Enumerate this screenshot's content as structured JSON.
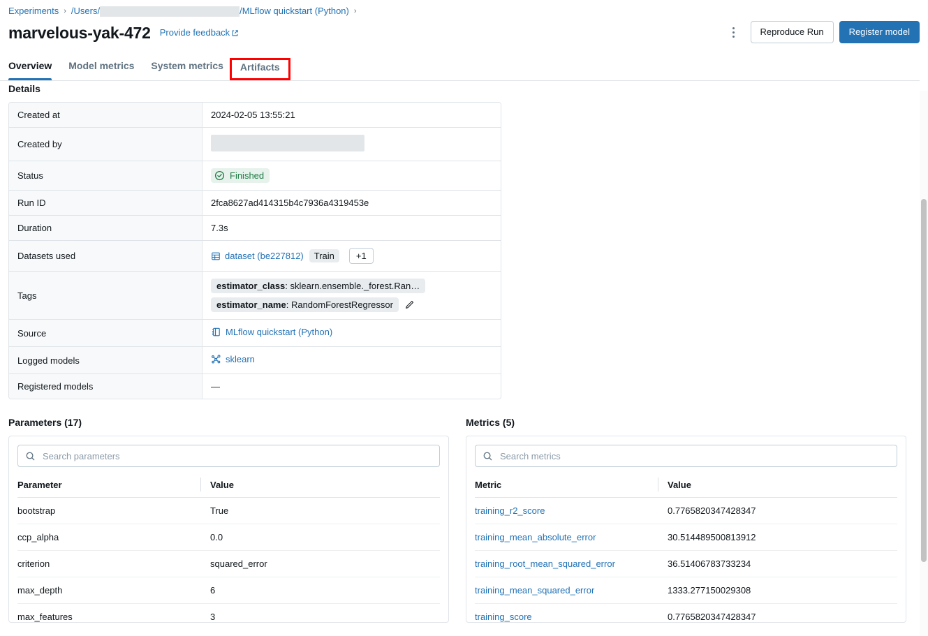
{
  "breadcrumb": {
    "root": "Experiments",
    "separator": "›",
    "path_prefix": "/Users/",
    "path_redacted": "",
    "path_suffix": "/MLflow quickstart (Python)",
    "trailing_separator": "›"
  },
  "header": {
    "run_name": "marvelous-yak-472",
    "feedback_label": "Provide feedback",
    "kebab_label": "More options",
    "reproduce_label": "Reproduce Run",
    "register_label": "Register model"
  },
  "tabs": [
    {
      "label": "Overview",
      "active": true,
      "highlighted": false
    },
    {
      "label": "Model metrics",
      "active": false,
      "highlighted": false
    },
    {
      "label": "System metrics",
      "active": false,
      "highlighted": false
    },
    {
      "label": "Artifacts",
      "active": false,
      "highlighted": true
    }
  ],
  "details": {
    "title": "Details",
    "rows": [
      {
        "label": "Created at",
        "type": "text",
        "value": "2024-02-05 13:55:21"
      },
      {
        "label": "Created by",
        "type": "redacted",
        "value": ""
      },
      {
        "label": "Status",
        "type": "status",
        "value": "Finished"
      },
      {
        "label": "Run ID",
        "type": "text",
        "value": "2fca8627ad414315b4c7936a4319453e"
      },
      {
        "label": "Duration",
        "type": "text",
        "value": "7.3s"
      },
      {
        "label": "Datasets used",
        "type": "datasets",
        "dataset_name": "dataset (be227812)",
        "dataset_tag": "Train",
        "more_count": "+1"
      },
      {
        "label": "Tags",
        "type": "tags",
        "tags": [
          {
            "key": "estimator_class",
            "value": "sklearn.ensemble._forest.Ran…"
          },
          {
            "key": "estimator_name",
            "value": "RandomForestRegressor"
          }
        ]
      },
      {
        "label": "Source",
        "type": "link",
        "value": "MLflow quickstart (Python)",
        "icon": "notebook-icon"
      },
      {
        "label": "Logged models",
        "type": "link",
        "value": "sklearn",
        "icon": "model-icon"
      },
      {
        "label": "Registered models",
        "type": "text",
        "value": "—"
      }
    ]
  },
  "parameters": {
    "title": "Parameters (17)",
    "search_placeholder": "Search parameters",
    "search_value": "",
    "columns": [
      "Parameter",
      "Value"
    ],
    "rows": [
      {
        "key": "bootstrap",
        "value": "True"
      },
      {
        "key": "ccp_alpha",
        "value": "0.0"
      },
      {
        "key": "criterion",
        "value": "squared_error"
      },
      {
        "key": "max_depth",
        "value": "6"
      },
      {
        "key": "max_features",
        "value": "3"
      }
    ]
  },
  "metrics": {
    "title": "Metrics (5)",
    "search_placeholder": "Search metrics",
    "search_value": "",
    "columns": [
      "Metric",
      "Value"
    ],
    "rows": [
      {
        "key": "training_r2_score",
        "value": "0.7765820347428347"
      },
      {
        "key": "training_mean_absolute_error",
        "value": "30.514489500813912"
      },
      {
        "key": "training_root_mean_squared_error",
        "value": "36.51406783733234"
      },
      {
        "key": "training_mean_squared_error",
        "value": "1333.277150029308"
      },
      {
        "key": "training_score",
        "value": "0.7765820347428347"
      }
    ]
  },
  "colors": {
    "accent": "#2272b4",
    "link": "#2272b4",
    "status_green": "#1f7a45",
    "status_green_bg": "#e6f2eb",
    "highlight_red": "#ff0000",
    "border": "#e0e4e8",
    "label_bg": "#f8f9fa"
  }
}
